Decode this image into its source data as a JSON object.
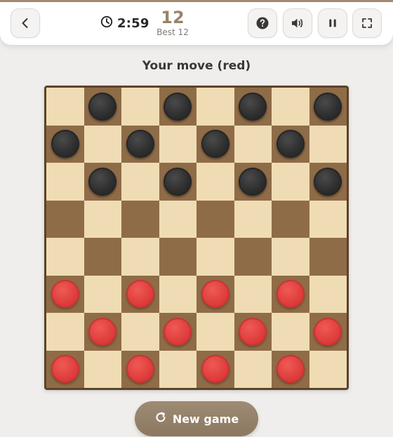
{
  "header": {
    "timer": "2:59",
    "score": "12",
    "best": "Best 12",
    "icons": {
      "back": "chevron-left-icon",
      "clock": "clock-icon",
      "help": "help-icon",
      "sound": "sound-icon",
      "pause": "pause-icon",
      "fullscreen": "fullscreen-icon"
    }
  },
  "status": "Your move (red)",
  "board": {
    "size": 8,
    "colors": {
      "light": "#efdcb5",
      "dark": "#8f6c48",
      "frame": "#5c4229",
      "black_piece": "#2e2e2e",
      "red_piece": "#dd3c3a"
    },
    "rows": [
      "-b-b-b-b",
      "b-b-b-b-",
      "-b-b-b-b",
      "--------",
      "--------",
      "r-r-r-r-",
      "-r-r-r-r",
      "r-r-r-r-"
    ]
  },
  "new_game": {
    "label": "New game",
    "icon": "restart-icon"
  }
}
